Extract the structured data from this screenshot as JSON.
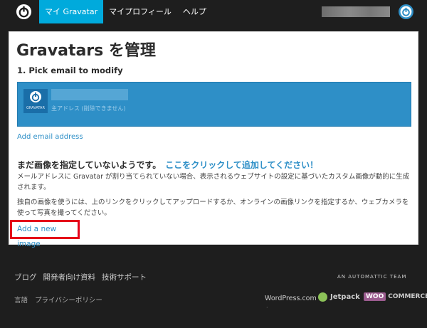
{
  "topbar": {
    "nav": [
      "マイ Gravatar",
      "マイプロフィール",
      "ヘルプ"
    ],
    "logo_icon": "gravatar-logo-icon",
    "avatar_icon": "gravatar-avatar-icon"
  },
  "main": {
    "title": "Gravatars を管理",
    "step": "1. Pick email to modify",
    "email_card": {
      "badge_label": "GRAVATAR",
      "primary_label": "主アドレス (削除できません)"
    },
    "add_email": "Add email address",
    "no_image": "まだ画像を指定していないようです。",
    "no_image_cta": "ここをクリックして追加してください！",
    "desc1": "メールアドレスに Gravatar が割り当てられていない場合、表示されるウェブサイトの設定に基づいたカスタム画像が動的に生成されます。",
    "desc2": "独自の画像を使うには、上のリンクをクリックしてアップロードするか、オンラインの画像リンクを指定するか、ウェブカメラを使って写真を撮ってください。",
    "add_new_image": "Add a new image"
  },
  "footer": {
    "row1": [
      "ブログ",
      "開発者向け資料",
      "技術サポート"
    ],
    "row2": [
      "言語",
      "プライバシーポリシー"
    ],
    "automattic": "AN AUTOMATTIC TEAM",
    "wordpress": "WordPress.com",
    "jetpack": "Jetpack",
    "woo_badge": "WOO",
    "woo_text": "COMMERCE",
    "dot": "·"
  },
  "colors": {
    "accent": "#00aadc",
    "link": "#2e8fc7",
    "highlight_border": "#e50019"
  }
}
